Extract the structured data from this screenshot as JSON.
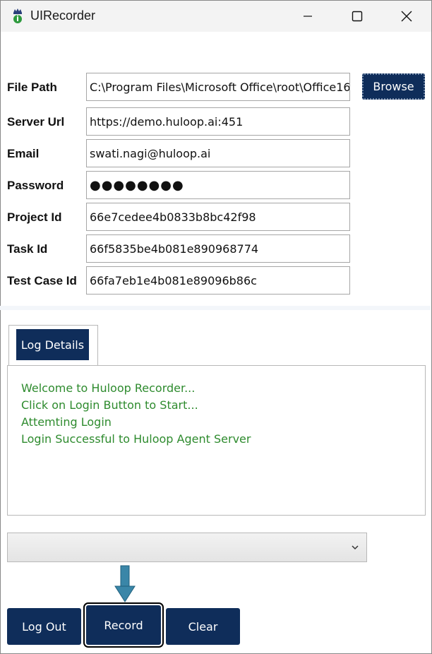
{
  "window": {
    "title": "UIRecorder"
  },
  "form": {
    "file_path": {
      "label": "File Path",
      "value": "C:\\Program Files\\Microsoft Office\\root\\Office16"
    },
    "browse_label": "Browse",
    "server_url": {
      "label": "Server Url",
      "value": "https://demo.huloop.ai:451"
    },
    "email": {
      "label": "Email",
      "value": "swati.nagi@huloop.ai"
    },
    "password": {
      "label": "Password",
      "value": "●●●●●●●●"
    },
    "project_id": {
      "label": "Project Id",
      "value": "66e7cedee4b0833b8bc42f98"
    },
    "task_id": {
      "label": "Task Id",
      "value": "66f5835be4b081e890968774"
    },
    "test_case_id": {
      "label": "Test Case Id",
      "value": "66fa7eb1e4b081e89096b86c"
    }
  },
  "log": {
    "tab_label": "Log Details",
    "lines": [
      "Welcome to Huloop Recorder...",
      "Click on Login Button to Start...",
      "Attemting Login",
      "Login Successful to Huloop Agent Server"
    ],
    "text_color": "#2e8b2e"
  },
  "dropdown": {
    "selected": ""
  },
  "buttons": {
    "logout": "Log Out",
    "record": "Record",
    "clear": "Clear"
  },
  "colors": {
    "accent": "#0f2d5a",
    "indicator_arrow": "#3a86a8"
  }
}
